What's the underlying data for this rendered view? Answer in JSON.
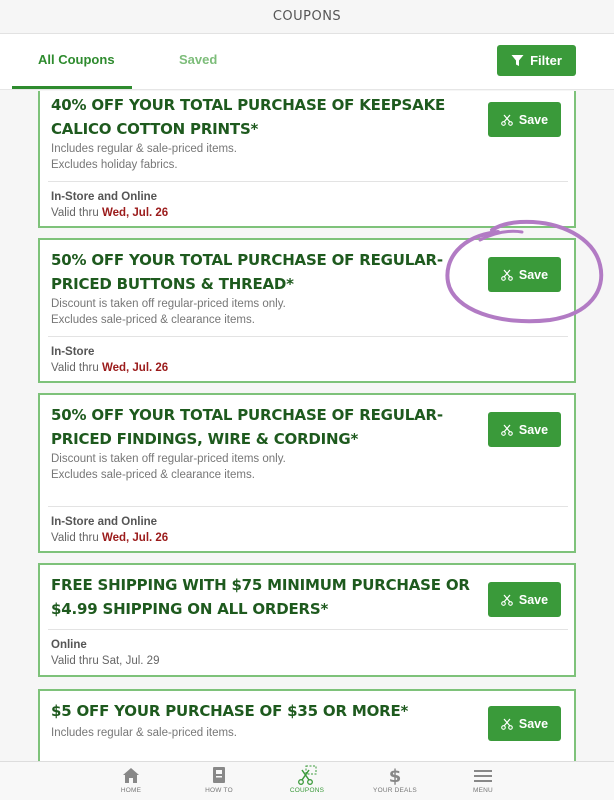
{
  "header": {
    "title": "COUPONS"
  },
  "tabs": {
    "all": "All Coupons",
    "saved": "Saved"
  },
  "filter": {
    "label": "Filter",
    "icon": "filter-icon"
  },
  "coupons": [
    {
      "title": "40% OFF YOUR TOTAL PURCHASE OF KEEPSAKE CALICO COTTON PRINTS*",
      "desc1": "Includes regular & sale-priced items.",
      "desc2": "Excludes holiday fabrics.",
      "location": "In-Store and Online",
      "valid_prefix": "Valid thru",
      "valid_date": "Wed, Jul. 26",
      "save": "Save"
    },
    {
      "title": "50% OFF YOUR TOTAL PURCHASE OF REGULAR-PRICED BUTTONS & THREAD*",
      "desc1": "Discount is taken off regular-priced items only.",
      "desc2": "Excludes sale-priced & clearance items.",
      "location": "In-Store",
      "valid_prefix": "Valid thru",
      "valid_date": "Wed, Jul. 26",
      "save": "Save"
    },
    {
      "title": "50% OFF YOUR TOTAL PURCHASE OF REGULAR-PRICED FINDINGS, WIRE & CORDING*",
      "desc1": "Discount is taken off regular-priced items only.",
      "desc2": "Excludes sale-priced & clearance items.",
      "location": "In-Store and Online",
      "valid_prefix": "Valid thru",
      "valid_date": "Wed, Jul. 26",
      "save": "Save"
    },
    {
      "title": "FREE SHIPPING WITH $75 MINIMUM PURCHASE OR $4.99 SHIPPING ON ALL ORDERS*",
      "location": "Online",
      "valid_text": "Valid thru Sat, Jul. 29",
      "save": "Save"
    },
    {
      "title": "$5 OFF YOUR PURCHASE OF $35 OR MORE*",
      "desc1": "Includes regular & sale-priced items.",
      "save": "Save"
    }
  ],
  "nav": {
    "home": "HOME",
    "howto": "HOW TO",
    "coupons": "COUPONS",
    "deals": "YOUR DEALS",
    "menu": "MENU"
  },
  "colors": {
    "brand_green": "#3a9a3a",
    "title_green": "#1e5a1e",
    "border_green": "#7ec27a",
    "date_red": "#9b1b1b",
    "highlight_purple": "#b27bc4"
  },
  "icons": [
    "scissors-icon",
    "filter-icon",
    "home-icon",
    "how-to-icon",
    "coupons-icon",
    "dollar-icon",
    "menu-icon"
  ]
}
